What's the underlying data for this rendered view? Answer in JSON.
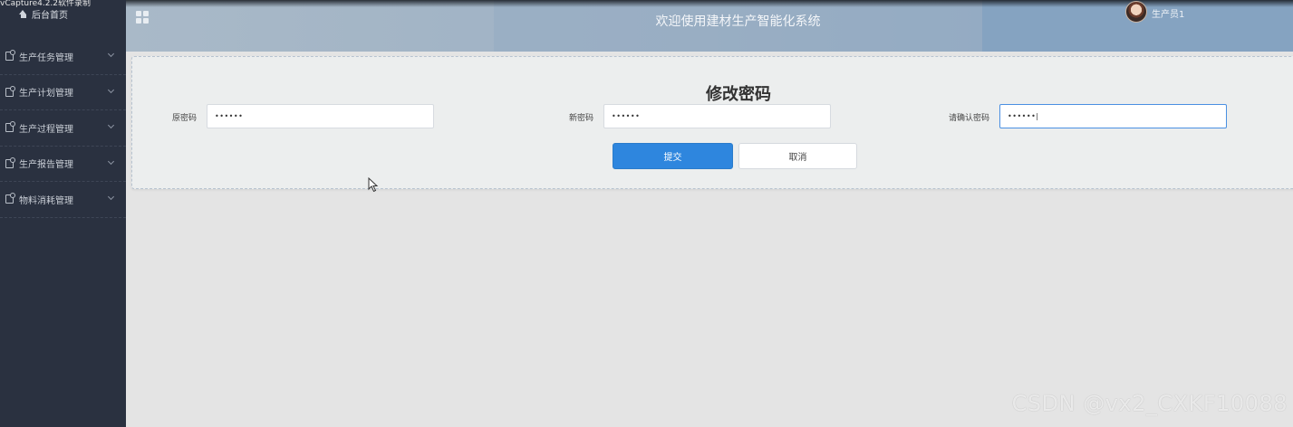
{
  "capture_text": "vCapture4.2.2软件录制",
  "sidebar": {
    "home_label": "后台首页",
    "items": [
      {
        "label": "生产任务管理"
      },
      {
        "label": "生产计划管理"
      },
      {
        "label": "生产过程管理"
      },
      {
        "label": "生产报告管理"
      },
      {
        "label": "物料消耗管理"
      }
    ]
  },
  "header": {
    "title": "欢迎使用建材生产智能化系统",
    "user_name": "生产员1"
  },
  "form": {
    "title": "修改密码",
    "old_password": {
      "label": "原密码",
      "value": "••••••"
    },
    "new_password": {
      "label": "新密码",
      "value": "••••••"
    },
    "confirm_password": {
      "label": "请确认密码",
      "value": "••••••|"
    },
    "submit_label": "提交",
    "cancel_label": "取消"
  },
  "watermark": "CSDN @vx2_CXKF10088",
  "colors": {
    "sidebar_bg": "#2a3140",
    "primary_button": "#2e86de",
    "header_accent": "#85a3c1"
  },
  "icons": {
    "home": "home-icon",
    "menu": "menu-item-icon",
    "grid": "grid-icon",
    "chevron": "chevron-down-icon"
  }
}
